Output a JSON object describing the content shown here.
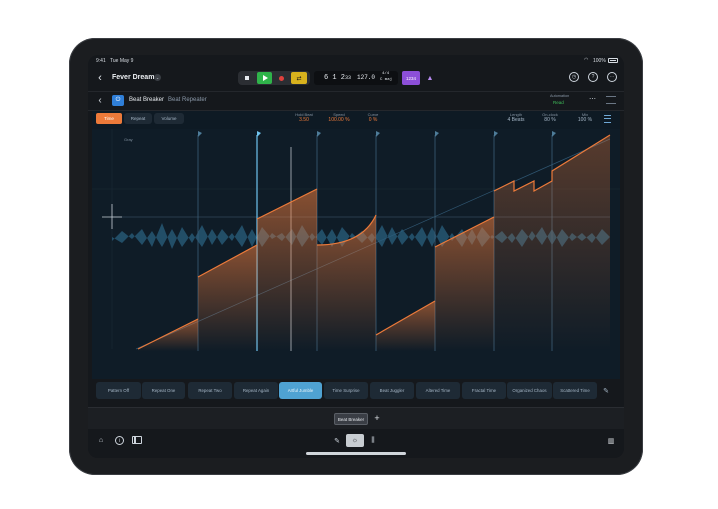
{
  "status": {
    "time": "9:41",
    "date": "Tue May 9",
    "battery": "100%"
  },
  "project": {
    "title": "Fever Dream"
  },
  "transport": {
    "position": "6 1 2",
    "position_sub": "33",
    "tempo": "127.0",
    "time_sig": "4/4",
    "key": "C maj",
    "count_in": "1234"
  },
  "plugin": {
    "name": "Beat Breaker",
    "preset": "Beat Repeater",
    "automation_label": "Automation",
    "automation_value": "Read"
  },
  "tabs": [
    "Time",
    "Repeat",
    "Volume"
  ],
  "params": [
    {
      "label": "Hold Beat",
      "value": "3.50"
    },
    {
      "label": "Speed",
      "value": "100.00 %"
    },
    {
      "label": "Curve",
      "value": "0 %"
    },
    {
      "label": "Length",
      "value": "4 Beats"
    },
    {
      "label": "On-clock",
      "value": "80 %"
    },
    {
      "label": "Mix",
      "value": "100 %"
    }
  ],
  "graph": {
    "corner_label": "Gray"
  },
  "presets": [
    "Pattern Off",
    "Repeat One",
    "Repeat Two",
    "Repeat Again",
    "Artful Jumble",
    "Time Surprise",
    "Beat Juggler",
    "Altered Time",
    "Fractal Time",
    "Organized Chaos",
    "Scattered Time"
  ],
  "selected_preset": "Artful Jumble",
  "bottom": {
    "chip": "Beat Breaker",
    "add": "+"
  },
  "colors": {
    "accent": "#ec7a3a",
    "selection": "#4fa2d2",
    "play": "#2fb34a",
    "record": "#e0413d",
    "cycle": "#d8b21d",
    "count_in": "#8c4fd8"
  }
}
